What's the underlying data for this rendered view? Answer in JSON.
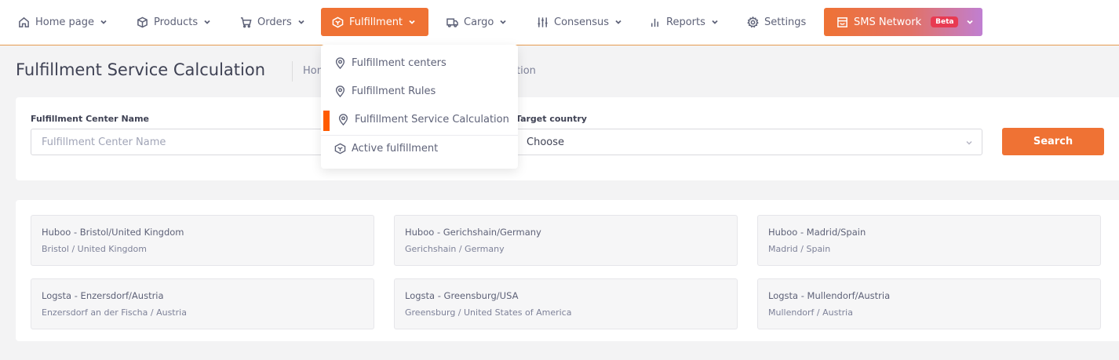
{
  "nav": {
    "items": [
      {
        "label": "Home page",
        "icon": "home-icon"
      },
      {
        "label": "Products",
        "icon": "box-icon"
      },
      {
        "label": "Orders",
        "icon": "cart-icon"
      },
      {
        "label": "Fulfillment",
        "icon": "fulfillment-icon",
        "active": true
      },
      {
        "label": "Cargo",
        "icon": "truck-icon"
      },
      {
        "label": "Consensus",
        "icon": "sliders-icon"
      },
      {
        "label": "Reports",
        "icon": "bar-chart-icon"
      },
      {
        "label": "Settings",
        "icon": "gear-icon"
      }
    ],
    "sms": {
      "label": "SMS Network",
      "badge": "Beta",
      "icon": "store-icon"
    }
  },
  "colors": {
    "accent": "#ef7234",
    "beta": "#e83a52",
    "active_indicator": "#ff5b00"
  },
  "page": {
    "title": "Fulfillment Service Calculation",
    "breadcrumb_head": "Hom",
    "breadcrumb_tail": "tion"
  },
  "dropdown": {
    "items": [
      {
        "label": "Fulfillment centers",
        "icon": "location-pin-icon"
      },
      {
        "label": "Fulfillment Rules",
        "icon": "location-pin-icon"
      },
      {
        "label": "Fulfillment Service Calculation",
        "icon": "location-pin-icon",
        "active": true
      },
      {
        "label": "Active fulfillment",
        "icon": "fulfillment-icon"
      }
    ]
  },
  "filters": {
    "center_name_label": "Fulfillment Center Name",
    "center_name_placeholder": "Fulfillment Center Name",
    "center_name_value": "",
    "target_country_label": "Target country",
    "target_country_value": "Choose",
    "search_label": "Search"
  },
  "centers": [
    {
      "name": "Huboo - Bristol/United Kingdom",
      "location": "Bristol / United Kingdom"
    },
    {
      "name": "Huboo - Gerichshain/Germany",
      "location": "Gerichshain / Germany"
    },
    {
      "name": "Huboo - Madrid/Spain",
      "location": "Madrid / Spain"
    },
    {
      "name": "Logsta - Enzersdorf/Austria",
      "location": "Enzersdorf an der Fischa / Austria"
    },
    {
      "name": "Logsta - Greensburg/USA",
      "location": "Greensburg / United States of America"
    },
    {
      "name": "Logsta - Mullendorf/Austria",
      "location": "Mullendorf / Austria"
    }
  ]
}
